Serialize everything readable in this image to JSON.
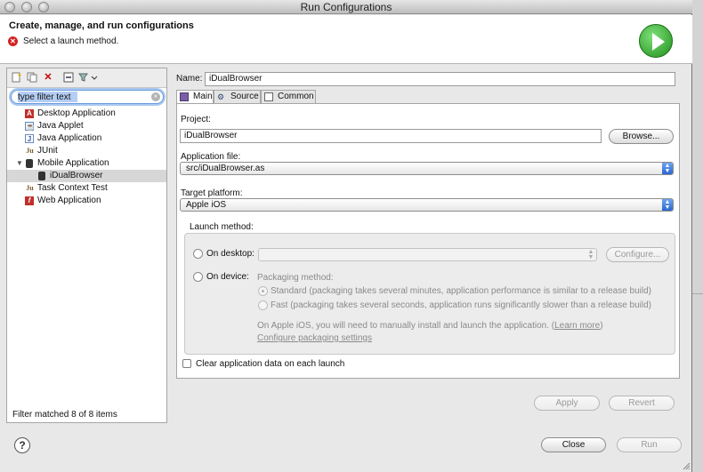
{
  "window": {
    "title": "Run Configurations"
  },
  "header": {
    "title": "Create, manage, and run configurations",
    "message": "Select a launch method.",
    "run_icon": "run-icon"
  },
  "left": {
    "toolbar_icons": [
      "new-configuration-icon",
      "duplicate-icon",
      "delete-icon",
      "collapse-all-icon",
      "filter-icon"
    ],
    "filter_placeholder": "type filter text",
    "filter_value": "type filter text",
    "tree": [
      {
        "label": "Desktop Application",
        "icon": "desktop-app-icon",
        "level": 1
      },
      {
        "label": "Java Applet",
        "icon": "java-applet-icon",
        "level": 1
      },
      {
        "label": "Java Application",
        "icon": "java-app-icon",
        "level": 1
      },
      {
        "label": "JUnit",
        "icon": "junit-icon",
        "level": 1
      },
      {
        "label": "Mobile Application",
        "icon": "mobile-app-icon",
        "level": 1,
        "expanded": true
      },
      {
        "label": "iDualBrowser",
        "icon": "mobile-config-icon",
        "level": 2,
        "selected": true
      },
      {
        "label": "Task Context Test",
        "icon": "task-context-icon",
        "level": 1
      },
      {
        "label": "Web Application",
        "icon": "web-app-icon",
        "level": 1
      }
    ],
    "status": "Filter matched 8 of 8 items"
  },
  "right": {
    "name_label": "Name:",
    "name_value": "iDualBrowser",
    "tabs": [
      {
        "label": "Main",
        "active": true
      },
      {
        "label": "Source",
        "active": false
      },
      {
        "label": "Common",
        "active": false
      }
    ],
    "project_label": "Project:",
    "project_value": "iDualBrowser",
    "browse_label": "Browse...",
    "app_file_label": "Application file:",
    "app_file_value": "src/iDualBrowser.as",
    "target_label": "Target platform:",
    "target_value": "Apple iOS",
    "launch_group_label": "Launch method:",
    "on_desktop_label": "On desktop:",
    "desktop_select_value": "",
    "configure_label": "Configure...",
    "on_device_label": "On device:",
    "packaging_label": "Packaging method:",
    "standard_label": "Standard (packaging takes several minutes, application performance is similar to a release build)",
    "fast_label": "Fast (packaging takes several seconds, application runs significantly slower than a release build)",
    "ios_note": "On Apple iOS, you will need to manually install and launch the application.",
    "learn_more_open": "(",
    "learn_more": "Learn more",
    "learn_more_close": ")",
    "configure_packaging": "Configure packaging settings",
    "clear_data_label": "Clear application data on each launch",
    "apply_label": "Apply",
    "revert_label": "Revert"
  },
  "footer": {
    "help_label": "?",
    "close_label": "Close",
    "run_label": "Run"
  }
}
